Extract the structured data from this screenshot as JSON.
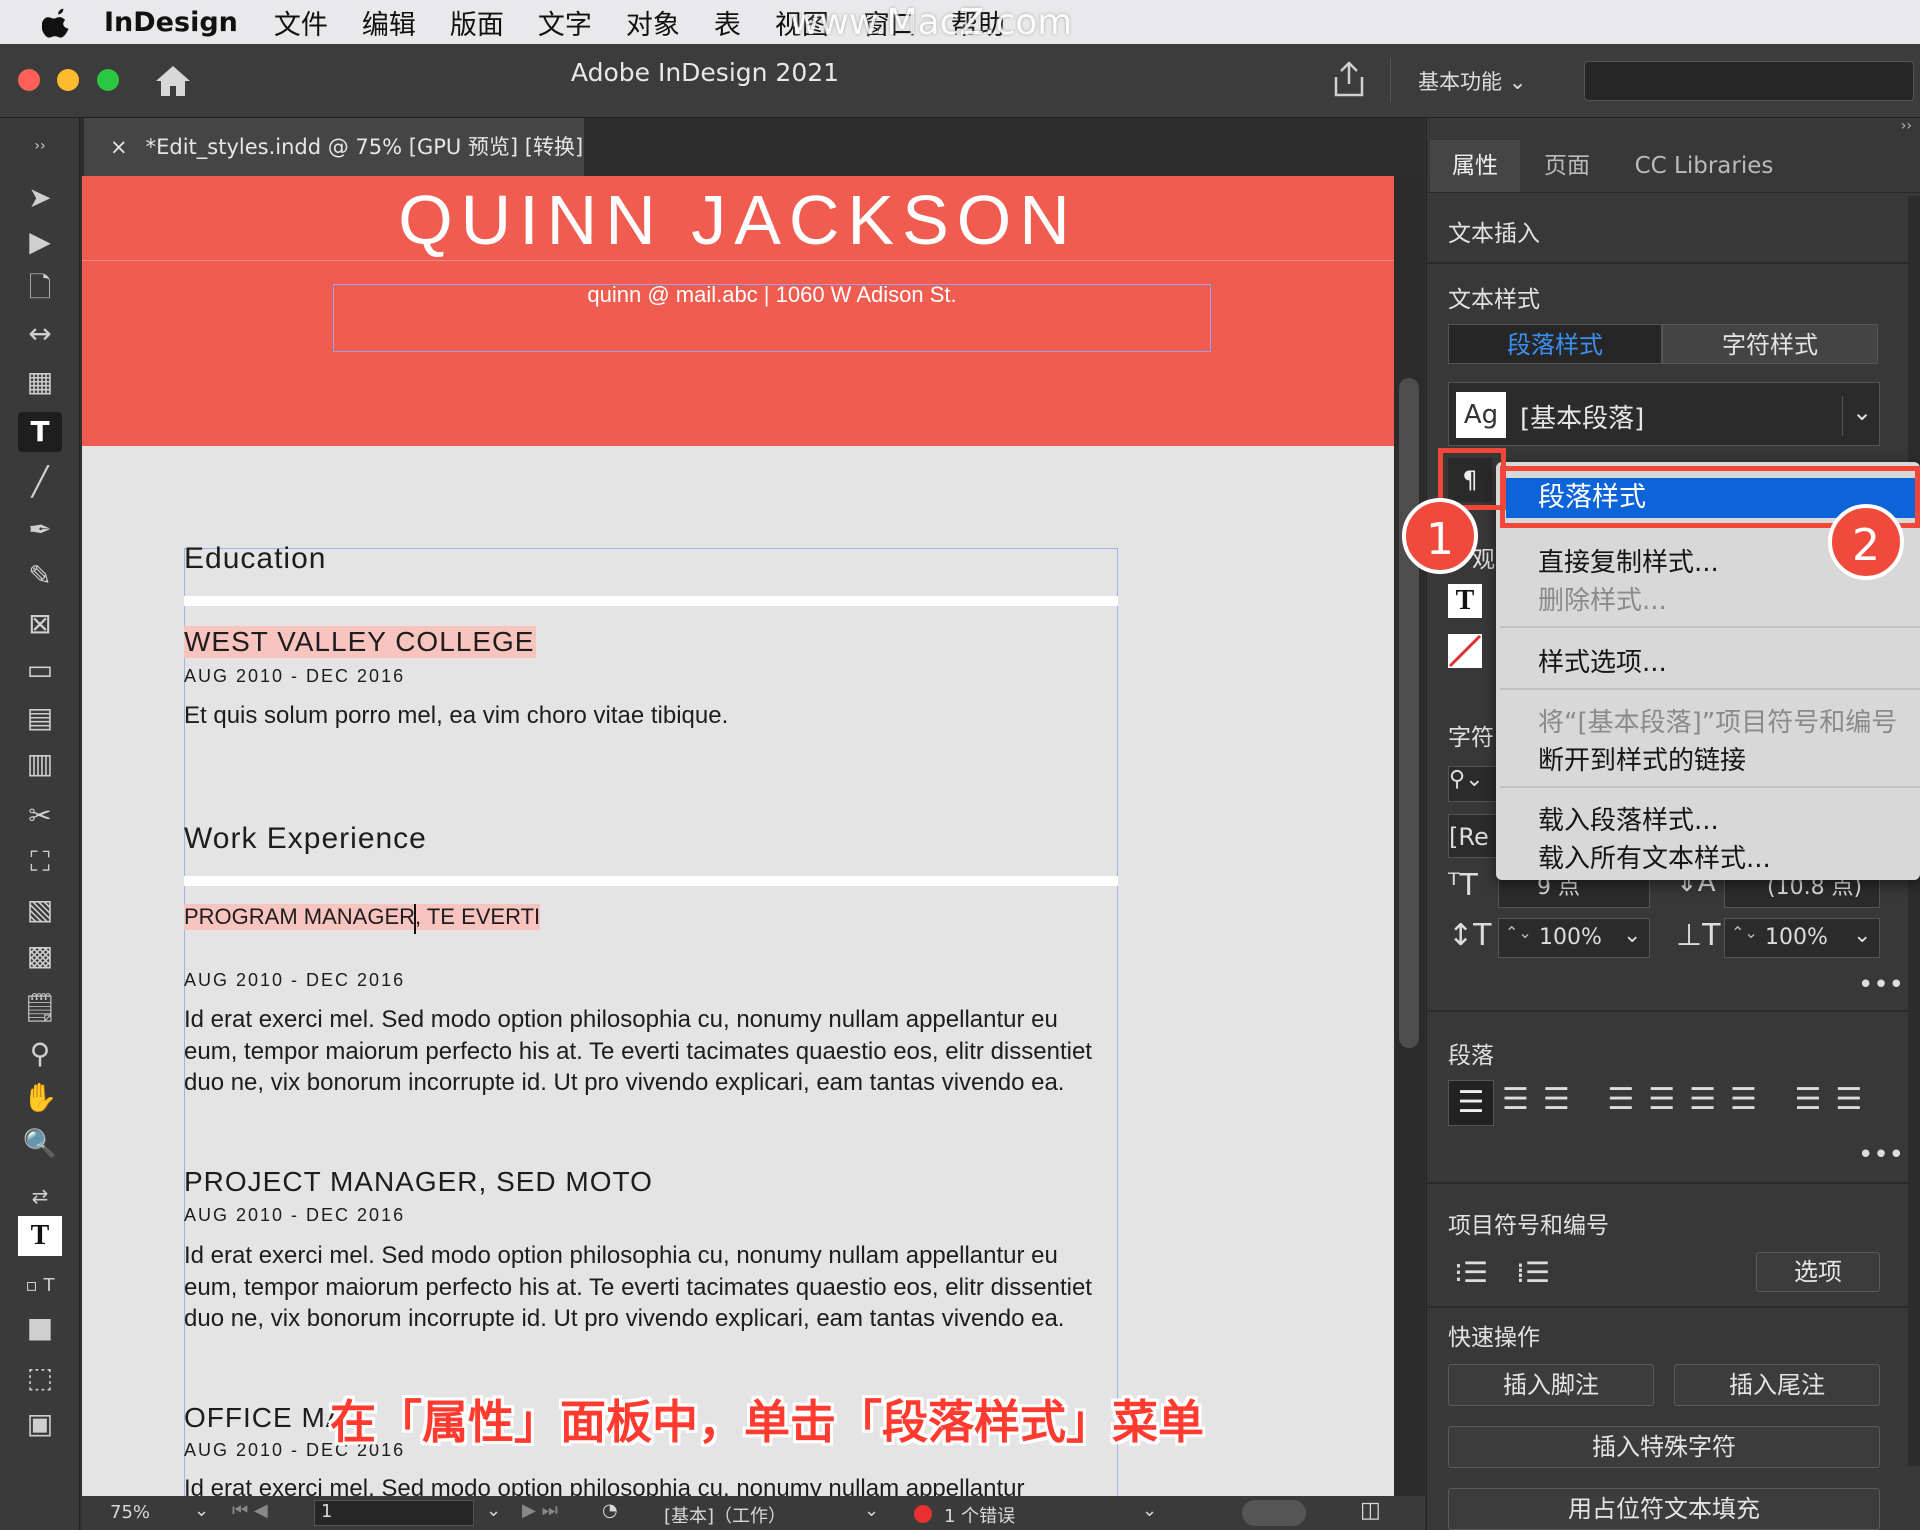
{
  "menubar": {
    "app": "InDesign",
    "items": [
      "文件",
      "编辑",
      "版面",
      "文字",
      "对象",
      "表",
      "视图",
      "窗口",
      "帮助"
    ],
    "watermark": "www.MacZ.com"
  },
  "titlebar": {
    "title": "Adobe InDesign 2021",
    "workspace": "基本功能"
  },
  "doctab": {
    "close": "×",
    "label": "*Edit_styles.indd @ 75% [GPU 预览] [转换]"
  },
  "document": {
    "name": "QUINN JACKSON",
    "contact": "quinn @ mail.abc | 1060 W Adison St.",
    "education_heading": "Education",
    "college": "WEST VALLEY COLLEGE",
    "college_dates": "AUG 2010 - DEC 2016",
    "college_text": "Et quis solum porro mel, ea vim choro vitae tibique.",
    "work_heading": "Work Experience",
    "job1_title": "PROGRAM MANAGER, TE EVERTI",
    "job1_dates": "AUG 2010 - DEC 2016",
    "job1_text": "Id erat exerci mel. Sed modo option philosophia cu, nonumy nullam appellantur eu eum, tempor maiorum perfecto his at. Te everti tacimates quaestio eos, elitr dissentiet duo ne, vix bonorum incorrupte id. Ut pro vivendo explicari, eam tantas vivendo ea.",
    "job2_title": "PROJECT MANAGER, SED MOTO",
    "job2_dates": "AUG 2010 - DEC 2016",
    "job2_text": "Id erat exerci mel. Sed modo option philosophia cu, nonumy nullam appellantur eu eum, tempor maiorum perfecto his at. Te everti tacimates quaestio eos, elitr dissentiet duo ne, vix bonorum incorrupte id. Ut pro vivendo explicari, eam tantas vivendo ea.",
    "job3_title": "OFFICE MA",
    "job3_dates": "AUG 2010 - DEC 2016",
    "job3_text": "Id erat exerci mel. Sed modo option philosophia cu, nonumy nullam appellantur"
  },
  "statusbar": {
    "zoom": "75%",
    "page": "1",
    "style": "[基本]（工作）",
    "errors": "1 个错误"
  },
  "panel": {
    "tabs": [
      "属性",
      "页面",
      "CC Libraries"
    ],
    "text_insert": "文本插入",
    "text_style": "文本样式",
    "seg_para": "段落样式",
    "seg_char": "字符样式",
    "style_ag": "Ag",
    "style_value": "[基本段落]",
    "appearance_partial": "观",
    "char_label": "字符",
    "font_partial": "[Re",
    "size_value": "9 点",
    "leading_value": "(10.8 点)",
    "hscale": "100%",
    "vscale": "100%",
    "paragraph": "段落",
    "bullets": "项目符号和编号",
    "options": "选项",
    "quick_actions": "快速操作",
    "footnote": "插入脚注",
    "endnote": "插入尾注",
    "special_char": "插入特殊字符",
    "placeholder": "用占位符文本填充"
  },
  "menu": {
    "selected": "段落样式",
    "items": [
      "直接复制样式...",
      "删除样式...",
      "样式选项...",
      "将“[基本段落]”项目符号和编号",
      "断开到样式的链接",
      "载入段落样式...",
      "载入所有文本样式..."
    ]
  },
  "badges": [
    "1",
    "2"
  ],
  "caption": "在「属性」面板中，单击「段落样式」菜单",
  "colors": {
    "header_red": "#f05c50",
    "highlight": "#0d64d8",
    "callout_red": "#f1463a"
  }
}
